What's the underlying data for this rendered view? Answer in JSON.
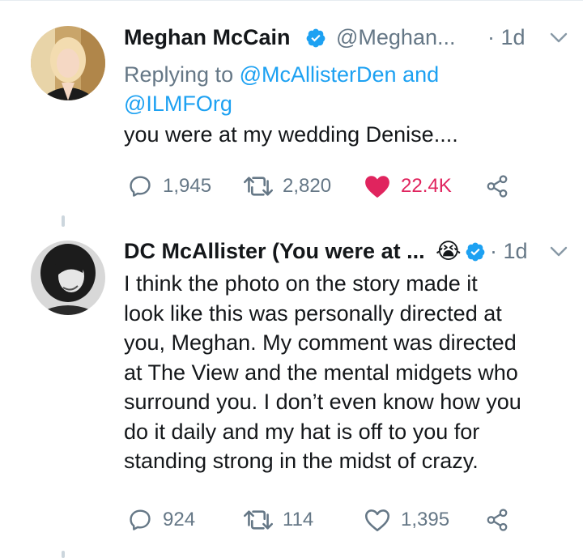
{
  "tweets": [
    {
      "author": "Meghan McCain",
      "handle": "@Meghan...",
      "time": "· 1d",
      "reply_prefix": "Replying to",
      "reply_to_1": "@McAllisterDen",
      "reply_and": "and",
      "reply_to_2": "@ILMFOrg",
      "text": "you were at my wedding Denise....",
      "replies": "1,945",
      "retweets": "2,820",
      "likes": "22.4K",
      "liked": true
    },
    {
      "author": "DC McAllister (You were at ...",
      "emoji": "😭",
      "time": "· 1d",
      "text_lines": [
        "I think the photo on the story made it",
        "look like this was personally directed at",
        "you, Meghan. My comment was directed",
        "at The View and the mental midgets who",
        "surround you. I don’t even know how you",
        "do it daily and my hat is off to you for",
        "standing strong in the midst of crazy."
      ],
      "replies": "924",
      "retweets": "114",
      "likes": "1,395",
      "liked": false
    }
  ],
  "colors": {
    "accent": "#1da1f2",
    "like": "#e0245e",
    "muted": "#657786",
    "text": "#14171a"
  }
}
